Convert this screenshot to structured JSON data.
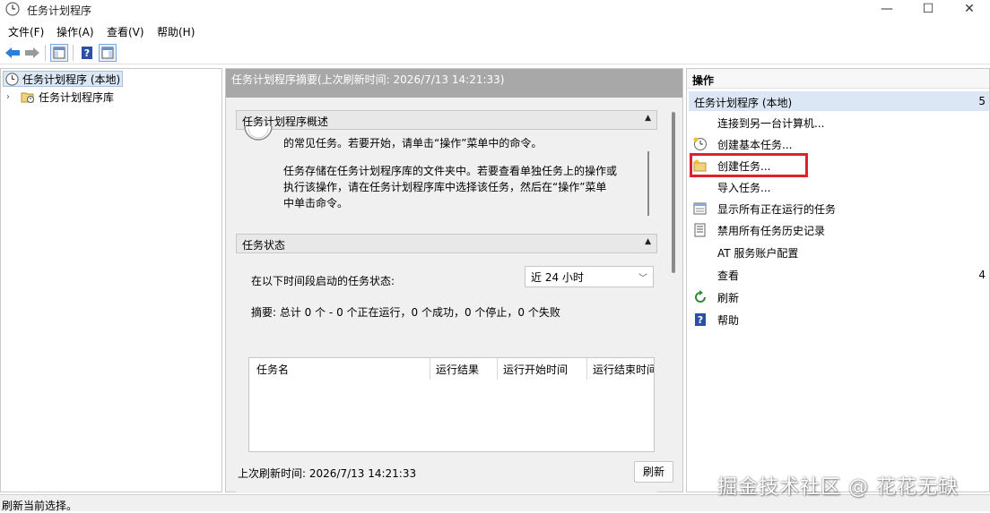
{
  "window": {
    "title": "任务计划程序",
    "controls": {
      "minimize": "—",
      "maximize": "☐",
      "close": "✕"
    }
  },
  "menubar": {
    "items": [
      "文件(F)",
      "操作(A)",
      "查看(V)",
      "帮助(H)"
    ]
  },
  "toolbar": {
    "icons": [
      "back-arrow-icon",
      "forward-arrow-icon",
      "show-hide-tree-icon",
      "help-icon",
      "show-action-pane-icon"
    ]
  },
  "tree": {
    "root": "任务计划程序 (本地)",
    "child": "任务计划程序库"
  },
  "center": {
    "header": "任务计划程序摘要(上次刷新时间: 2026/7/13 14:21:33)",
    "overview": {
      "title": "任务计划程序概述",
      "line1": "的常见任务。若要开始，请单击“操作”菜单中的命令。",
      "para2_line1": "任务存储在任务计划程序库的文件夹中。若要查看单独任务上的操作或",
      "para2_line2": "执行该操作，请在任务计划程序库中选择该任务，然后在“操作”菜单",
      "para2_line3": "中单击命令。"
    },
    "status": {
      "title": "任务状态",
      "period_label": "在以下时间段启动的任务状态:",
      "period_value": "近 24 小时",
      "summary": "摘要: 总计 0 个 - 0 个正在运行，0 个成功，0 个停止，0 个失败",
      "columns": [
        "任务名",
        "运行结果",
        "运行开始时间",
        "运行结束时间"
      ]
    },
    "footer": {
      "last_refresh": "上次刷新时间: 2026/7/13 14:21:33",
      "refresh_button": "刷新"
    }
  },
  "actions": {
    "title": "操作",
    "section": "任务计划程序 (本地)",
    "items": [
      {
        "label": "连接到另一台计算机...",
        "icon": ""
      },
      {
        "label": "创建基本任务...",
        "icon": "create-basic-task-icon"
      },
      {
        "label": "创建任务...",
        "icon": "create-task-icon"
      },
      {
        "label": "导入任务...",
        "icon": ""
      },
      {
        "label": "显示所有正在运行的任务",
        "icon": "running-tasks-icon"
      },
      {
        "label": "禁用所有任务历史记录",
        "icon": "history-icon"
      },
      {
        "label": "AT 服务账户配置",
        "icon": ""
      },
      {
        "label": "查看",
        "icon": ""
      },
      {
        "label": "刷新",
        "icon": "refresh-icon"
      },
      {
        "label": "帮助",
        "icon": "help-icon"
      }
    ]
  },
  "statusbar": {
    "text": "刷新当前选择。"
  },
  "watermark": {
    "text": "掘金技术社区 @ 花花无缺"
  },
  "colors": {
    "highlight": "#e0202a",
    "header_bg": "#a8a8a8",
    "selection": "#dbe7f5"
  }
}
